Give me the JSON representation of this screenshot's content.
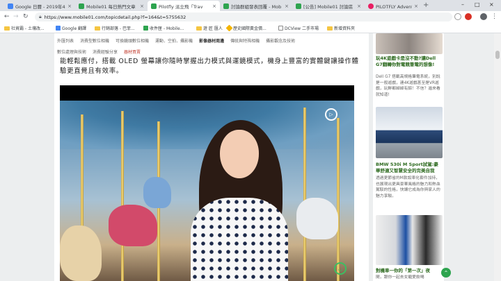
{
  "browser": {
    "tabs": [
      {
        "title": "Google 日曆 - 2019年4月",
        "favicon_color": "#4285f4",
        "active": false
      },
      {
        "title": "Mobile01 每日熱門文章",
        "favicon_color": "#2ea44f",
        "active": false
      },
      {
        "title": "Pilotfly 派立飛「Trav",
        "favicon_color": "#2ea44f",
        "active": true
      },
      {
        "title": "討論群組發表回覆 - Mob",
        "favicon_color": "#2ea44f",
        "active": false
      },
      {
        "title": "[公告] Mobile01 討論區",
        "favicon_color": "#2ea44f",
        "active": false
      },
      {
        "title": "PILOTFLY Adventure 胖",
        "favicon_color": "#e91e63",
        "active": false
      }
    ],
    "close_glyph": "×",
    "new_tab_glyph": "+",
    "window_controls": [
      "–",
      "□",
      "×"
    ],
    "url": "https://www.mobile01.com/topicdetail.php?f=164&t=5755632",
    "bookmarks": [
      {
        "label": "社貿霸 - 土壤改...",
        "icon": "folder"
      },
      {
        "label": "Google 翻譯",
        "icon": "translate-icon",
        "color": "#4285f4"
      },
      {
        "label": "行銷部落 - 巴菲...",
        "icon": "folder"
      },
      {
        "label": "收件匣 - Mobile...",
        "icon": "mail-icon",
        "color": "#2ea44f"
      },
      {
        "label": "遊 匠 匯人",
        "icon": "folder"
      },
      {
        "label": "歷史國際黃金價...",
        "icon": "gold-icon",
        "color": "#f4b400"
      },
      {
        "label": "DCView 二手市場",
        "icon": "page-icon",
        "color": "#888888"
      },
      {
        "label": "新增資料夾",
        "icon": "folder"
      }
    ]
  },
  "page": {
    "subnav_row1": [
      {
        "label": "外匯列表",
        "style": "normal"
      },
      {
        "label": "消費型數位相機",
        "style": "normal"
      },
      {
        "label": "可換鏡頭數位相機",
        "style": "normal"
      },
      {
        "label": "運動．空拍．攝影機",
        "style": "normal"
      },
      {
        "label": "影像器材周邊",
        "style": "bold"
      },
      {
        "label": "傳統與特殊相機",
        "style": "normal"
      },
      {
        "label": "攝影觀念及技術",
        "style": "normal"
      }
    ],
    "subnav_row2": [
      {
        "label": "數位處理與技術",
        "style": "normal"
      },
      {
        "label": "消費經驗分享",
        "style": "normal"
      },
      {
        "label": "器材買賣",
        "style": "on"
      }
    ],
    "article_text": "能輕鬆應付，搭載 OLED 螢幕讓你隨時掌握出力模式與運鏡模式，機身上豐富的實體鍵讓操作體驗更直覺且有效率。",
    "video_play_icon": "▷",
    "video_vr_icon": "◡"
  },
  "sidebar": {
    "cards": [
      {
        "title": "玩4K遊戲卡是沒不動?讓Dell G7翻轉你對電競筆電的想像!",
        "desc": "Dell G7 搭載高規格筆電系統，別說是一般遊戲，連4K遊戲甚至是VR遊戲，玩鮮都綽綽有餘！不信？進來看就知道!"
      },
      {
        "title": "BMW 530i M Sport試駕:豪華舒適又智慧安全的完美自我",
        "desc": "透過更節省的M款設車化套件加持，也展現出更具豪華風格的魅力和熱血駕馭的性格，快讓它成為你與家人的魅力享駿。"
      },
      {
        "title": "對機車一你的「第一次」夜",
        "desc": "間，跟你一起去女寵愛飲喝"
      }
    ]
  }
}
